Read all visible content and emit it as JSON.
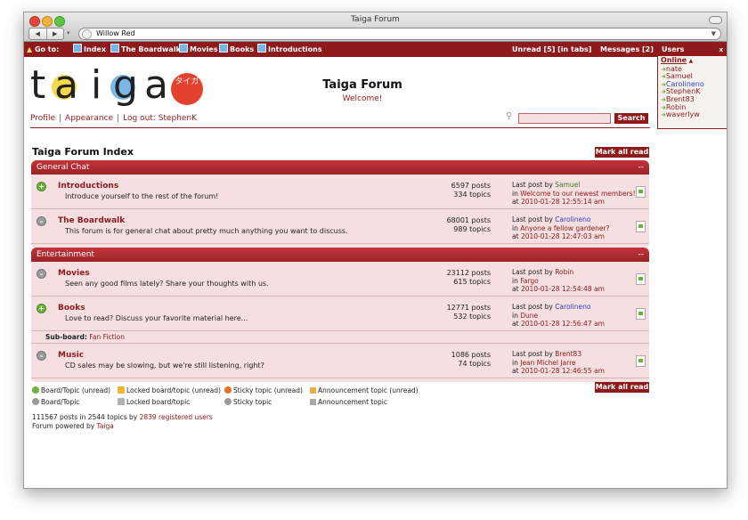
{
  "window": {
    "title": "Taiga Forum"
  },
  "browser": {
    "url": "Willow Red"
  },
  "topnav": {
    "goto": "Go to:",
    "items": [
      "Index",
      "The Boardwalk",
      "Movies",
      "Books",
      "Introductions"
    ],
    "unread": "Unread [5] [in tabs]",
    "messages": "Messages [2]"
  },
  "users_panel": {
    "title": "Users",
    "close": "x",
    "online": "Online",
    "users": [
      "nate",
      "Samuel",
      "Carolineno",
      "StephenK",
      "Brent83",
      "Robin",
      "waverlyw"
    ]
  },
  "header": {
    "logo_letters": [
      "t",
      "a",
      "i",
      "g",
      "a"
    ],
    "logo_kana": "タイガ",
    "title": "Taiga Forum",
    "subtitle": "Welcome!",
    "links": [
      "Profile",
      "Appearance",
      "Log out: StephenK"
    ],
    "search_button": "Search"
  },
  "index": {
    "title": "Taiga Forum Index",
    "mark_all_read": "Mark all read"
  },
  "categories": [
    {
      "name": "General Chat",
      "toggle": "--",
      "boards": [
        {
          "name": "Introductions",
          "desc": "Introduce yourself to the rest of the forum!",
          "posts": "6597 posts",
          "topics": "334 topics",
          "lp_label": "Last post by",
          "lp_user": "Samuel",
          "lp_in": "in",
          "lp_topic": "Welcome to our newest members!",
          "lp_at": "at",
          "lp_time": "2010-01-28 12:55:14 am"
        },
        {
          "name": "The Boardwalk",
          "desc": "This forum is for general chat about pretty much anything you want to discuss.",
          "posts": "68001 posts",
          "topics": "989 topics",
          "lp_label": "Last post by",
          "lp_user": "Carolineno",
          "lp_in": "in",
          "lp_topic": "Anyone a fellow gardener?",
          "lp_at": "at",
          "lp_time": "2010-01-28 12:47:03 am"
        }
      ]
    },
    {
      "name": "Entertainment",
      "toggle": "--",
      "boards": [
        {
          "name": "Movies",
          "desc": "Seen any good films lately? Share your thoughts with us.",
          "posts": "23112 posts",
          "topics": "615 topics",
          "lp_label": "Last post by",
          "lp_user": "Robin",
          "lp_in": "in",
          "lp_topic": "Fargo",
          "lp_at": "at",
          "lp_time": "2010-01-28 12:54:48 am"
        },
        {
          "name": "Books",
          "desc": "Love to read? Discuss your favorite material here...",
          "posts": "12771 posts",
          "topics": "532 topics",
          "lp_label": "Last post by",
          "lp_user": "Carolineno",
          "lp_in": "in",
          "lp_topic": "Dune",
          "lp_at": "at",
          "lp_time": "2010-01-28 12:56:47 am"
        },
        {
          "name": "Music",
          "desc": "CD sales may be slowing, but we're still listening, right?",
          "posts": "1086 posts",
          "topics": "74 topics",
          "lp_label": "Last post by",
          "lp_user": "Brent83",
          "lp_in": "in",
          "lp_topic": "Jean Michel Jarre",
          "lp_at": "at",
          "lp_time": "2010-01-28 12:46:55 am"
        }
      ],
      "subboard_label": "Sub-board:",
      "subboard_link": "Fan Fiction"
    }
  ],
  "legend": {
    "row1": [
      "Board/Topic (unread)",
      "Locked board/topic (unread)",
      "Sticky topic (unread)",
      "Announcement topic (unread)"
    ],
    "row2": [
      "Board/Topic",
      "Locked board/topic",
      "Sticky topic",
      "Announcement topic"
    ]
  },
  "footer": {
    "stats_text": "111567 posts in 2544 topics by",
    "stats_link": "2839 registered users",
    "powered_text": "Forum powered by",
    "powered_link": "Taiga"
  },
  "colors": {
    "accent": "#8e1a1b",
    "row_bg": "#f5dfe0",
    "link_blue": "#2e3dc4"
  }
}
